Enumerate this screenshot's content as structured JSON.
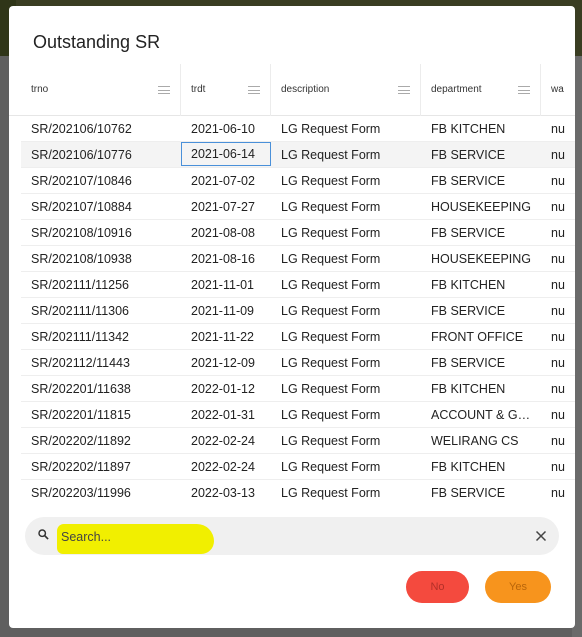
{
  "dialog": {
    "title": "Outstanding SR"
  },
  "grid": {
    "columns": [
      "trno",
      "trdt",
      "description",
      "department",
      "wa"
    ],
    "rows": [
      {
        "trno": "SR/202106/10762",
        "trdt": "2021-06-10",
        "description": "LG Request Form",
        "department": "FB KITCHEN",
        "wa": "nu"
      },
      {
        "trno": "SR/202106/10776",
        "trdt": "2021-06-14",
        "description": "LG Request Form",
        "department": "FB SERVICE",
        "wa": "nu"
      },
      {
        "trno": "SR/202107/10846",
        "trdt": "2021-07-02",
        "description": "LG Request Form",
        "department": "FB SERVICE",
        "wa": "nu"
      },
      {
        "trno": "SR/202107/10884",
        "trdt": "2021-07-27",
        "description": "LG Request Form",
        "department": "HOUSEKEEPING",
        "wa": "nu"
      },
      {
        "trno": "SR/202108/10916",
        "trdt": "2021-08-08",
        "description": "LG Request Form",
        "department": "FB SERVICE",
        "wa": "nu"
      },
      {
        "trno": "SR/202108/10938",
        "trdt": "2021-08-16",
        "description": "LG Request Form",
        "department": "HOUSEKEEPING",
        "wa": "nu"
      },
      {
        "trno": "SR/202111/11256",
        "trdt": "2021-11-01",
        "description": "LG Request Form",
        "department": "FB KITCHEN",
        "wa": "nu"
      },
      {
        "trno": "SR/202111/11306",
        "trdt": "2021-11-09",
        "description": "LG Request Form",
        "department": "FB SERVICE",
        "wa": "nu"
      },
      {
        "trno": "SR/202111/11342",
        "trdt": "2021-11-22",
        "description": "LG Request Form",
        "department": "FRONT OFFICE",
        "wa": "nu"
      },
      {
        "trno": "SR/202112/11443",
        "trdt": "2021-12-09",
        "description": "LG Request Form",
        "department": "FB SERVICE",
        "wa": "nu"
      },
      {
        "trno": "SR/202201/11638",
        "trdt": "2022-01-12",
        "description": "LG Request Form",
        "department": "FB KITCHEN",
        "wa": "nu"
      },
      {
        "trno": "SR/202201/11815",
        "trdt": "2022-01-31",
        "description": "LG Request Form",
        "department": "ACCOUNT & G…",
        "wa": "nu"
      },
      {
        "trno": "SR/202202/11892",
        "trdt": "2022-02-24",
        "description": "LG Request Form",
        "department": "WELIRANG CS",
        "wa": "nu"
      },
      {
        "trno": "SR/202202/11897",
        "trdt": "2022-02-24",
        "description": "LG Request Form",
        "department": "FB KITCHEN",
        "wa": "nu"
      },
      {
        "trno": "SR/202203/11996",
        "trdt": "2022-03-13",
        "description": "LG Request Form",
        "department": "FB SERVICE",
        "wa": "nu"
      }
    ],
    "selected_row": 1
  },
  "search": {
    "placeholder": "Search...",
    "value": "",
    "icon": "search-icon",
    "clear_icon": "close-icon",
    "highlight_color": "#f1ef00"
  },
  "actions": {
    "no_label": "No",
    "yes_label": "Yes",
    "no_color": "#f44a3e",
    "yes_color": "#f7941d"
  }
}
